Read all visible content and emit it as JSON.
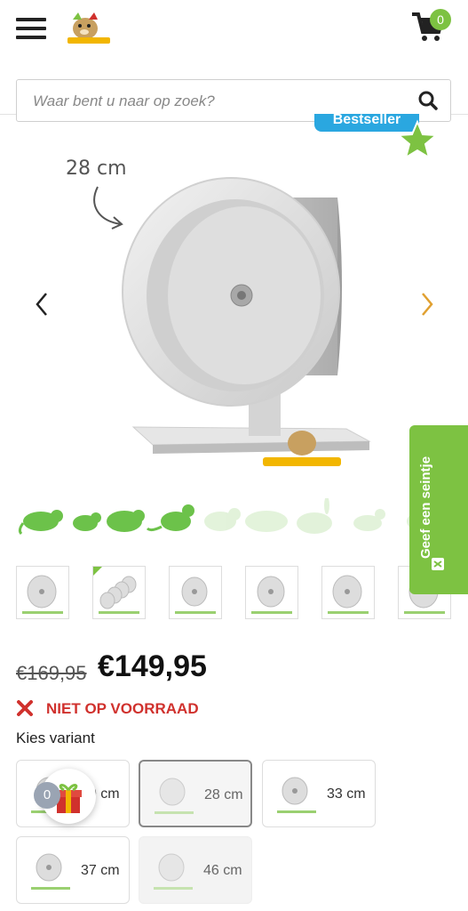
{
  "header": {
    "cart_count": "0"
  },
  "search": {
    "placeholder": "Waar bent u naar op zoek?"
  },
  "product": {
    "badge": "Bestseller",
    "dimension_label": "28 cm",
    "price_old": "€169,95",
    "price_new": "€149,95",
    "stock_status": "NIET OP VOORRAAD",
    "variant_heading": "Kies variant",
    "variants": [
      {
        "label": "20 cm",
        "state": "normal"
      },
      {
        "label": "28 cm",
        "state": "selected"
      },
      {
        "label": "33 cm",
        "state": "normal"
      },
      {
        "label": "37 cm",
        "state": "normal"
      },
      {
        "label": "46 cm",
        "state": "disabled"
      }
    ]
  },
  "feedback": {
    "label": "Geef een seintje"
  },
  "gift": {
    "count": "0"
  },
  "colors": {
    "brand_green": "#7dc242",
    "bestseller_blue": "#2aa7e0",
    "stock_red": "#d0312d",
    "arrow_orange": "#e0a030"
  }
}
